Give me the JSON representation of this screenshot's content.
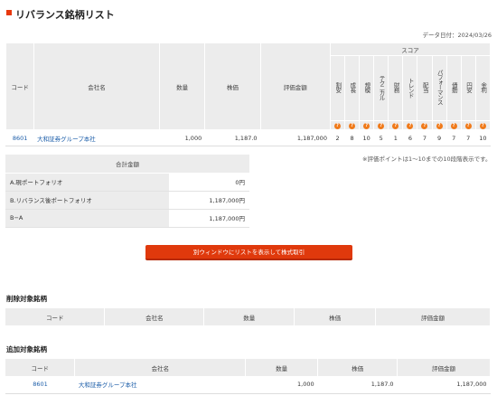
{
  "page": {
    "title": "リバランス銘柄リスト",
    "date": "データ日付：2024/03/26"
  },
  "main_table": {
    "headers": {
      "code": "コード",
      "company": "会社名",
      "quantity": "数量",
      "price": "株価",
      "value": "評価金額",
      "score": "スコア"
    },
    "score_columns": [
      "割安",
      "成長",
      "規模",
      "テクニカル",
      "財務",
      "トレンド",
      "配当",
      "パフォーマンス",
      "債動",
      "円安",
      "金利"
    ],
    "help_icon": "?",
    "rows": [
      {
        "code": "8601",
        "company": "大和証券グループ本社",
        "quantity": "1,000",
        "price": "1,187.0",
        "value": "1,187,000",
        "scores": [
          "2",
          "8",
          "10",
          "5",
          "1",
          "6",
          "7",
          "9",
          "7",
          "7",
          "10"
        ]
      }
    ]
  },
  "note": "※評価ポイントは1〜10までの10段階表示です。",
  "summary": {
    "header": "合計金額",
    "rows": [
      {
        "label": "A.現ポートフォリオ",
        "value": "0円"
      },
      {
        "label": "B.リバランス後ポートフォリオ",
        "value": "1,187,000円"
      },
      {
        "label": "B−A",
        "value": "1,187,000円"
      }
    ]
  },
  "button_label": "別ウィンドウにリストを表示して株式取引",
  "delete_section": {
    "title": "削除対象銘柄",
    "headers": [
      "コード",
      "会社名",
      "数量",
      "株価",
      "評価金額"
    ]
  },
  "add_section": {
    "title": "追加対象銘柄",
    "headers": [
      "コード",
      "会社名",
      "数量",
      "株価",
      "評価金額"
    ],
    "rows": [
      {
        "code": "8601",
        "company": "大和証券グループ本社",
        "quantity": "1,000",
        "price": "1,187.0",
        "value": "1,187,000"
      }
    ]
  },
  "colors": {
    "accent": "#e0390c",
    "help_icon": "#f07a1a",
    "link": "#1a5ca8",
    "header_bg": "#ececec"
  }
}
